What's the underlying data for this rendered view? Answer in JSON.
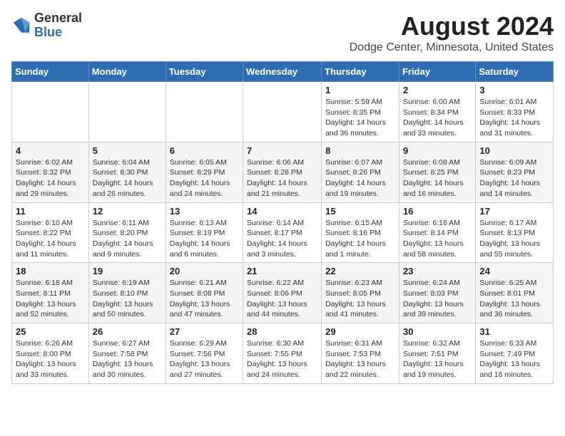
{
  "logo": {
    "line1": "General",
    "line2": "Blue"
  },
  "header": {
    "title": "August 2024",
    "subtitle": "Dodge Center, Minnesota, United States"
  },
  "weekdays": [
    "Sunday",
    "Monday",
    "Tuesday",
    "Wednesday",
    "Thursday",
    "Friday",
    "Saturday"
  ],
  "weeks": [
    [
      {
        "day": "",
        "info": ""
      },
      {
        "day": "",
        "info": ""
      },
      {
        "day": "",
        "info": ""
      },
      {
        "day": "",
        "info": ""
      },
      {
        "day": "1",
        "info": "Sunrise: 5:59 AM\nSunset: 8:35 PM\nDaylight: 14 hours and 36 minutes."
      },
      {
        "day": "2",
        "info": "Sunrise: 6:00 AM\nSunset: 8:34 PM\nDaylight: 14 hours and 33 minutes."
      },
      {
        "day": "3",
        "info": "Sunrise: 6:01 AM\nSunset: 8:33 PM\nDaylight: 14 hours and 31 minutes."
      }
    ],
    [
      {
        "day": "4",
        "info": "Sunrise: 6:02 AM\nSunset: 8:32 PM\nDaylight: 14 hours and 29 minutes."
      },
      {
        "day": "5",
        "info": "Sunrise: 6:04 AM\nSunset: 8:30 PM\nDaylight: 14 hours and 26 minutes."
      },
      {
        "day": "6",
        "info": "Sunrise: 6:05 AM\nSunset: 8:29 PM\nDaylight: 14 hours and 24 minutes."
      },
      {
        "day": "7",
        "info": "Sunrise: 6:06 AM\nSunset: 8:28 PM\nDaylight: 14 hours and 21 minutes."
      },
      {
        "day": "8",
        "info": "Sunrise: 6:07 AM\nSunset: 8:26 PM\nDaylight: 14 hours and 19 minutes."
      },
      {
        "day": "9",
        "info": "Sunrise: 6:08 AM\nSunset: 8:25 PM\nDaylight: 14 hours and 16 minutes."
      },
      {
        "day": "10",
        "info": "Sunrise: 6:09 AM\nSunset: 8:23 PM\nDaylight: 14 hours and 14 minutes."
      }
    ],
    [
      {
        "day": "11",
        "info": "Sunrise: 6:10 AM\nSunset: 8:22 PM\nDaylight: 14 hours and 11 minutes."
      },
      {
        "day": "12",
        "info": "Sunrise: 6:11 AM\nSunset: 8:20 PM\nDaylight: 14 hours and 9 minutes."
      },
      {
        "day": "13",
        "info": "Sunrise: 6:13 AM\nSunset: 8:19 PM\nDaylight: 14 hours and 6 minutes."
      },
      {
        "day": "14",
        "info": "Sunrise: 6:14 AM\nSunset: 8:17 PM\nDaylight: 14 hours and 3 minutes."
      },
      {
        "day": "15",
        "info": "Sunrise: 6:15 AM\nSunset: 8:16 PM\nDaylight: 14 hours and 1 minute."
      },
      {
        "day": "16",
        "info": "Sunrise: 6:16 AM\nSunset: 8:14 PM\nDaylight: 13 hours and 58 minutes."
      },
      {
        "day": "17",
        "info": "Sunrise: 6:17 AM\nSunset: 8:13 PM\nDaylight: 13 hours and 55 minutes."
      }
    ],
    [
      {
        "day": "18",
        "info": "Sunrise: 6:18 AM\nSunset: 8:11 PM\nDaylight: 13 hours and 52 minutes."
      },
      {
        "day": "19",
        "info": "Sunrise: 6:19 AM\nSunset: 8:10 PM\nDaylight: 13 hours and 50 minutes."
      },
      {
        "day": "20",
        "info": "Sunrise: 6:21 AM\nSunset: 8:08 PM\nDaylight: 13 hours and 47 minutes."
      },
      {
        "day": "21",
        "info": "Sunrise: 6:22 AM\nSunset: 8:06 PM\nDaylight: 13 hours and 44 minutes."
      },
      {
        "day": "22",
        "info": "Sunrise: 6:23 AM\nSunset: 8:05 PM\nDaylight: 13 hours and 41 minutes."
      },
      {
        "day": "23",
        "info": "Sunrise: 6:24 AM\nSunset: 8:03 PM\nDaylight: 13 hours and 39 minutes."
      },
      {
        "day": "24",
        "info": "Sunrise: 6:25 AM\nSunset: 8:01 PM\nDaylight: 13 hours and 36 minutes."
      }
    ],
    [
      {
        "day": "25",
        "info": "Sunrise: 6:26 AM\nSunset: 8:00 PM\nDaylight: 13 hours and 33 minutes."
      },
      {
        "day": "26",
        "info": "Sunrise: 6:27 AM\nSunset: 7:58 PM\nDaylight: 13 hours and 30 minutes."
      },
      {
        "day": "27",
        "info": "Sunrise: 6:29 AM\nSunset: 7:56 PM\nDaylight: 13 hours and 27 minutes."
      },
      {
        "day": "28",
        "info": "Sunrise: 6:30 AM\nSunset: 7:55 PM\nDaylight: 13 hours and 24 minutes."
      },
      {
        "day": "29",
        "info": "Sunrise: 6:31 AM\nSunset: 7:53 PM\nDaylight: 13 hours and 22 minutes."
      },
      {
        "day": "30",
        "info": "Sunrise: 6:32 AM\nSunset: 7:51 PM\nDaylight: 13 hours and 19 minutes."
      },
      {
        "day": "31",
        "info": "Sunrise: 6:33 AM\nSunset: 7:49 PM\nDaylight: 13 hours and 16 minutes."
      }
    ]
  ]
}
